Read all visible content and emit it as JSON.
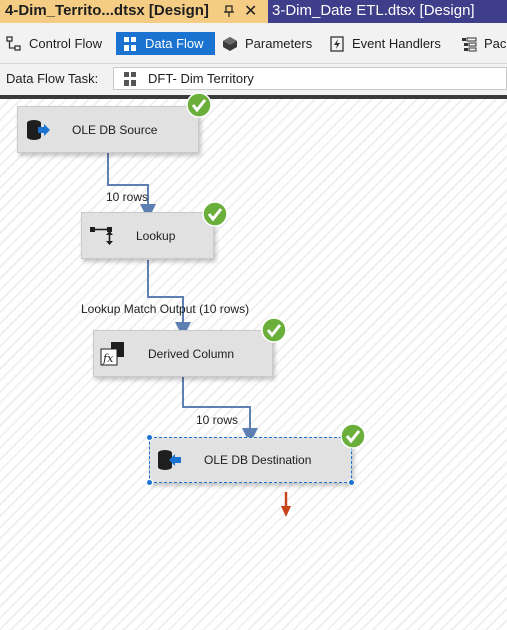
{
  "tabs": {
    "active_title": "4-Dim_Territo...dtsx [Design]",
    "close_glyph": "✕",
    "inactive_title": "3-Dim_Date ETL.dtsx [Design]"
  },
  "designer_tabs": [
    {
      "label": "Control Flow",
      "icon": "control-flow-icon"
    },
    {
      "label": "Data Flow",
      "icon": "data-flow-icon",
      "active": true
    },
    {
      "label": "Parameters",
      "icon": "parameters-icon"
    },
    {
      "label": "Event Handlers",
      "icon": "event-handlers-icon"
    },
    {
      "label": "Pac",
      "icon": "package-explorer-icon"
    }
  ],
  "task": {
    "label": "Data Flow Task:",
    "value": "DFT- Dim Territory"
  },
  "components": {
    "source": {
      "label": "OLE DB Source",
      "status": "success"
    },
    "lookup": {
      "label": "Lookup",
      "status": "success"
    },
    "derived": {
      "label": "Derived Column",
      "status": "success"
    },
    "destination": {
      "label": "OLE DB Destination",
      "status": "success"
    }
  },
  "paths": {
    "source_to_lookup": "10 rows",
    "lookup_to_derived": "Lookup Match Output (10 rows)",
    "derived_to_destination": "10 rows"
  },
  "colors": {
    "active_tab": "#f5cc84",
    "tab_strip": "#2d2d6b",
    "selected_designer_tab": "#1a73d1",
    "success_check": "#6aaf3a",
    "flow_path": "#5e7fb2",
    "error_path": "#c7441b"
  }
}
